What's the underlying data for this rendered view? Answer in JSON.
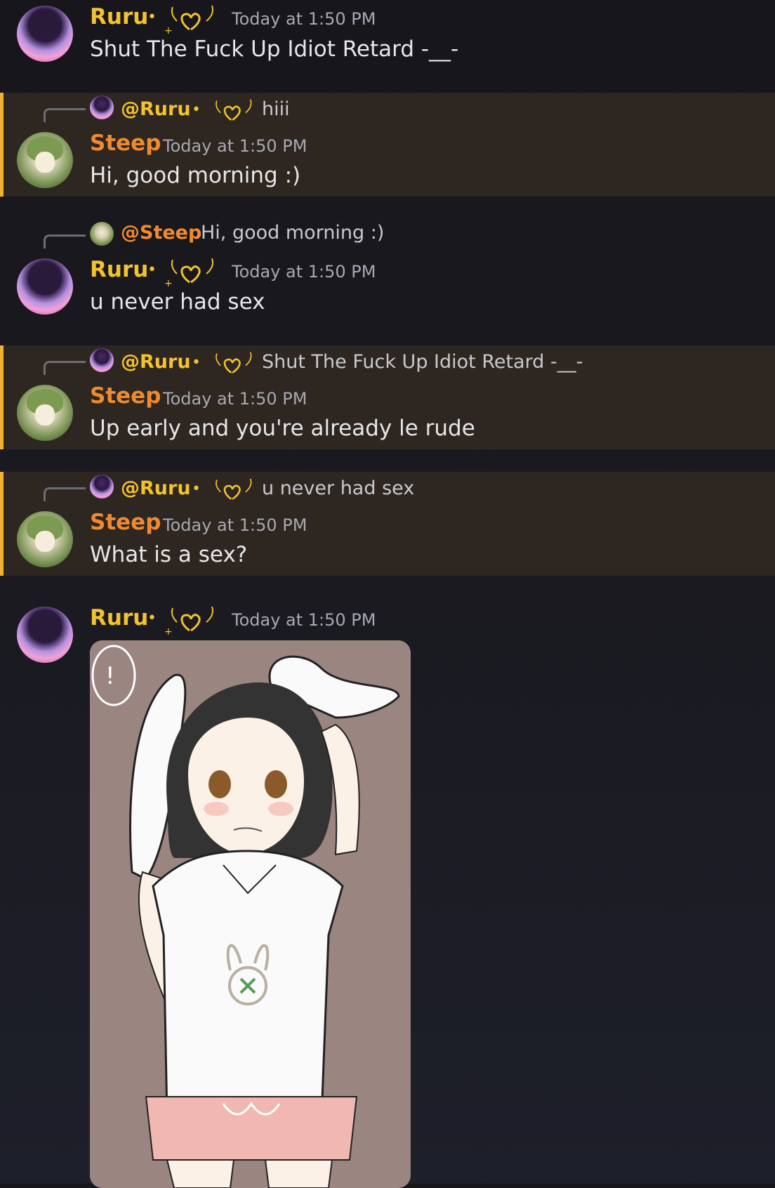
{
  "messages": [
    {
      "author": "Ruru",
      "separator": "•",
      "timestamp": "Today at 1:50 PM",
      "text": "Shut The Fuck Up Idiot Retard -__-"
    },
    {
      "reply": {
        "author": "@Ruru",
        "separator": "•",
        "text": "hiii"
      },
      "author": "Steep",
      "timestamp": "Today at 1:50 PM",
      "text": "Hi, good morning :)"
    },
    {
      "reply": {
        "author": "@Steep",
        "text": "Hi, good morning :)"
      },
      "author": "Ruru",
      "separator": "•",
      "timestamp": "Today at 1:50 PM",
      "text": "u never had sex"
    },
    {
      "reply": {
        "author": "@Ruru",
        "separator": "•",
        "text": "Shut The Fuck Up Idiot Retard -__-"
      },
      "author": "Steep",
      "timestamp": "Today at 1:50 PM",
      "text": "Up early and you're already le rude"
    },
    {
      "reply": {
        "author": "@Ruru",
        "separator": "•",
        "text": "u never had sex"
      },
      "author": "Steep",
      "timestamp": "Today at 1:50 PM",
      "text": "What is a sex?"
    },
    {
      "author": "Ruru",
      "separator": "•",
      "timestamp": "Today at 1:50 PM",
      "attachment": "image"
    }
  ],
  "colors": {
    "ruru": "#f2c22f",
    "steep": "#f08a30",
    "mention_bar": "#f0b232",
    "mention_bg": "#2e2620"
  },
  "icons": {
    "badge": "winged-heart-icon"
  }
}
